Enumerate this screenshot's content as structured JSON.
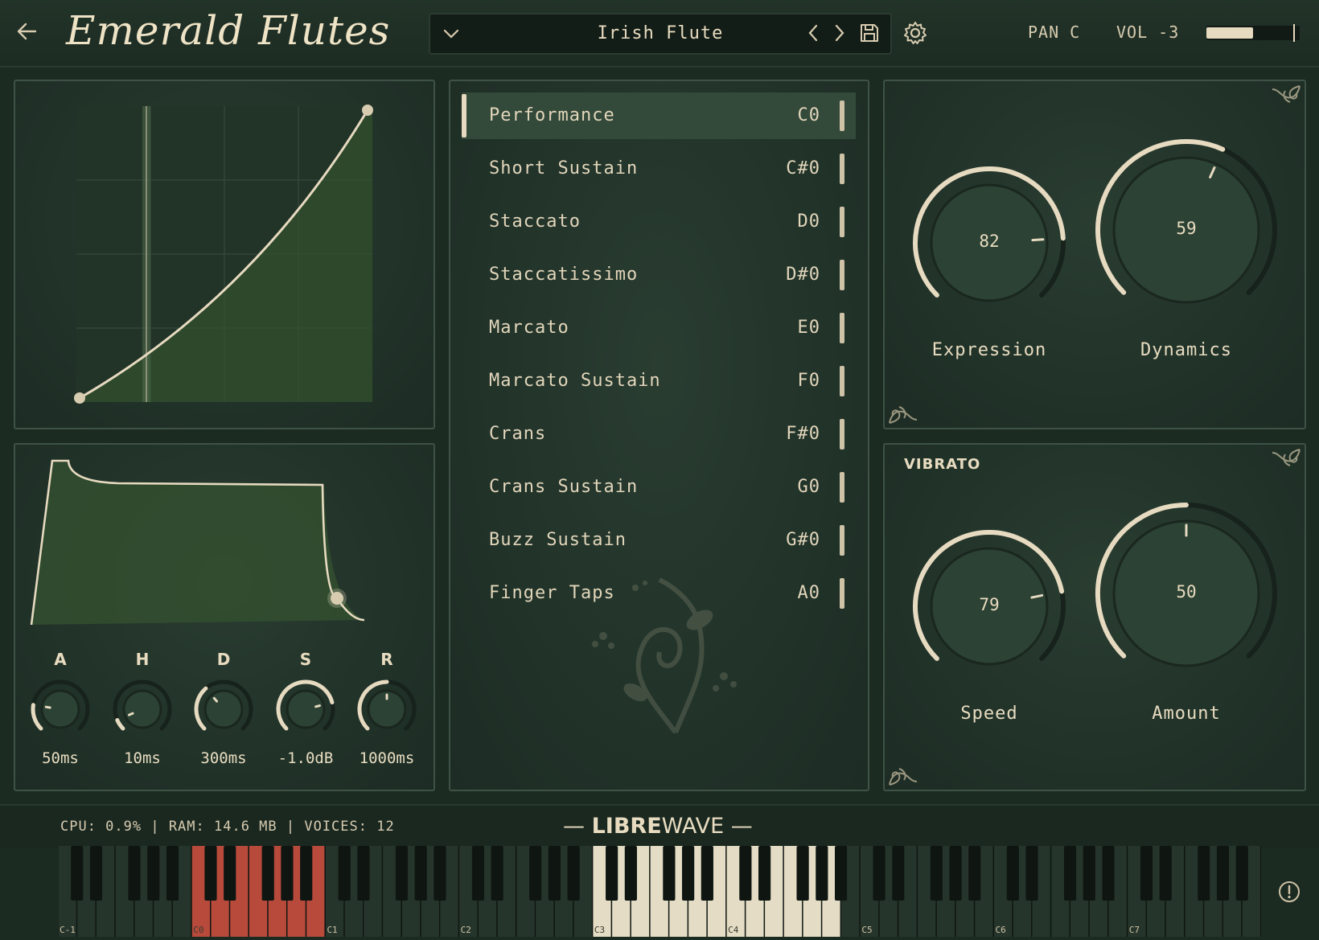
{
  "header": {
    "title": "Emerald Flutes",
    "preset": "Irish Flute",
    "pan": "PAN C",
    "vol": "VOL -3",
    "vol_level": 0.5
  },
  "articulations": [
    {
      "name": "Performance",
      "key": "C0",
      "active": true
    },
    {
      "name": "Short Sustain",
      "key": "C#0",
      "active": false
    },
    {
      "name": "Staccato",
      "key": "D0",
      "active": false
    },
    {
      "name": "Staccatissimo",
      "key": "D#0",
      "active": false
    },
    {
      "name": "Marcato",
      "key": "E0",
      "active": false
    },
    {
      "name": "Marcato Sustain",
      "key": "F0",
      "active": false
    },
    {
      "name": "Crans",
      "key": "F#0",
      "active": false
    },
    {
      "name": "Crans Sustain",
      "key": "G0",
      "active": false
    },
    {
      "name": "Buzz Sustain",
      "key": "G#0",
      "active": false
    },
    {
      "name": "Finger Taps",
      "key": "A0",
      "active": false
    }
  ],
  "envelope": {
    "knobs": [
      {
        "letter": "A",
        "value": "50ms"
      },
      {
        "letter": "H",
        "value": "10ms"
      },
      {
        "letter": "D",
        "value": "300ms"
      },
      {
        "letter": "S",
        "value": "-1.0dB"
      },
      {
        "letter": "R",
        "value": "1000ms"
      }
    ]
  },
  "expression": {
    "label": "Expression",
    "value": "82"
  },
  "dynamics": {
    "label": "Dynamics",
    "value": "59"
  },
  "vibrato": {
    "title": "VIBRATO",
    "speed": {
      "label": "Speed",
      "value": "79"
    },
    "amount": {
      "label": "Amount",
      "value": "50"
    }
  },
  "status": {
    "text": "CPU: 0.9% | RAM: 14.6 MB | VOICES: 12"
  },
  "logo": {
    "bold": "LIBRE",
    "rest": "WAVE"
  },
  "keyboard": {
    "octave_labels": [
      "C-1",
      "C0",
      "C1",
      "C2",
      "C3",
      "C4",
      "C5",
      "C6",
      "C7"
    ]
  },
  "colors": {
    "accent": "#e6dac0",
    "panel": "#24362b",
    "key_red": "#b84a3c"
  }
}
